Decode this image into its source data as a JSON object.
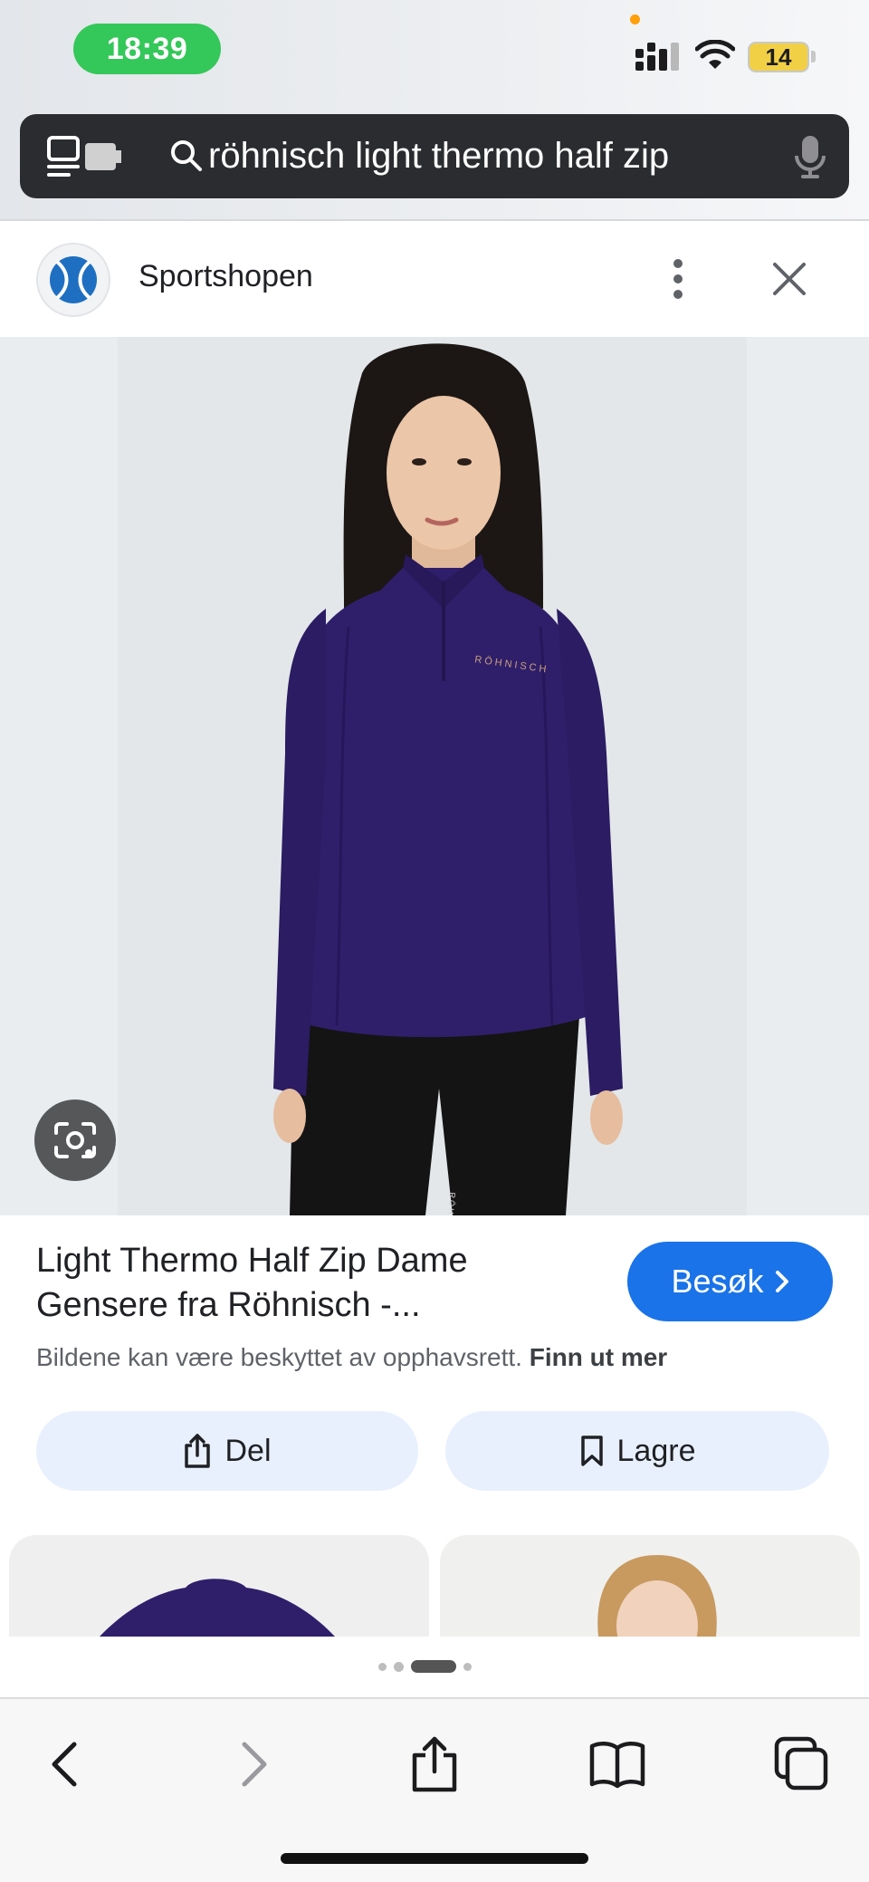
{
  "status_bar": {
    "time": "18:39",
    "battery_level": "14"
  },
  "url_bar": {
    "query": "röhnisch light thermo half zip"
  },
  "source": {
    "name": "Sportshopen"
  },
  "product": {
    "title_line1": "Light Thermo Half Zip Dame",
    "title_line2": "Gensere fra Röhnisch -...",
    "visit_label": "Besøk",
    "copyright_text": "Bildene kan være beskyttet av opphavsrett.",
    "learn_more_label": "Finn ut mer",
    "garment_brand_print": "RÖHNISCH",
    "legging_brand_print": "RÖHNISCH"
  },
  "actions": {
    "share_label": "Del",
    "save_label": "Lagre"
  },
  "pager": {
    "total": 4,
    "active_index": 2
  },
  "colors": {
    "accent": "#1a73e8",
    "time_pill": "#34c759",
    "garment": "#2f1f6b",
    "chip_bg": "#e8f0fe"
  },
  "icons": {
    "tabs": "tab-overview-icon",
    "search": "search-icon",
    "mic": "mic-icon",
    "more": "more-vert-icon",
    "close": "close-icon",
    "lens": "lens-icon",
    "share": "share-icon",
    "bookmark": "bookmark-icon",
    "back": "back-icon",
    "forward": "forward-icon",
    "book": "bookmarks-book-icon",
    "tabs_toolbar": "tabs-icon"
  }
}
